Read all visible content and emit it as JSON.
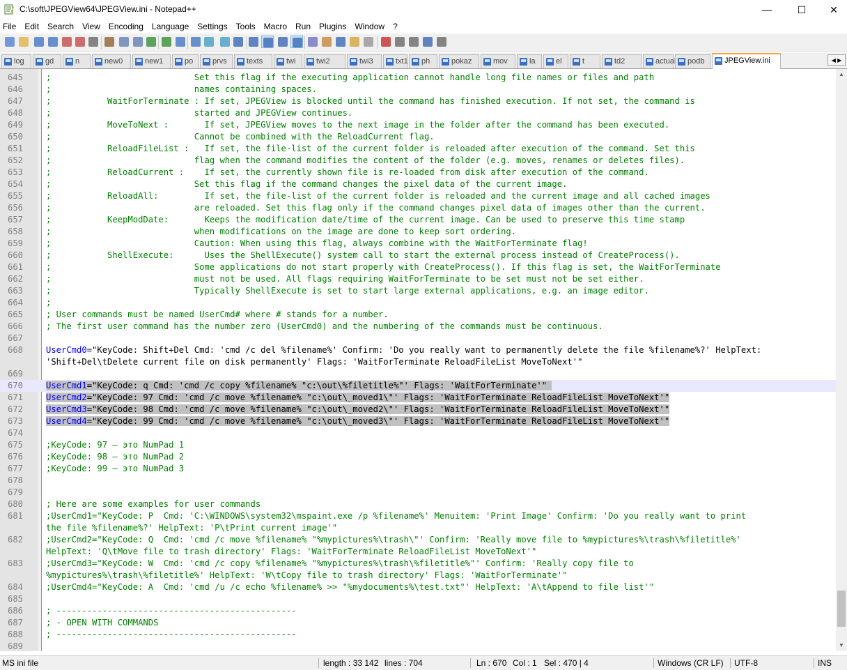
{
  "window": {
    "title": "C:\\soft\\JPEGView64\\JPEGView.ini - Notepad++",
    "minimize_glyph": "—",
    "maximize_glyph": "☐",
    "close_glyph": "✕"
  },
  "menu": [
    "File",
    "Edit",
    "Search",
    "View",
    "Encoding",
    "Language",
    "Settings",
    "Tools",
    "Macro",
    "Run",
    "Plugins",
    "Window",
    "?"
  ],
  "toolbar_icons": [
    "new-icon",
    "open-icon",
    "save-icon",
    "save-all-icon",
    "close-icon",
    "close-all-icon",
    "print-icon",
    "cut-icon",
    "copy-icon",
    "paste-icon",
    "undo-icon",
    "redo-icon",
    "find-icon",
    "replace-icon",
    "zoom-in-icon",
    "zoom-out-icon",
    "sync-vertical-icon",
    "sync-horizontal-icon",
    "word-wrap-icon",
    "show-all-chars-icon",
    "indent-guide-icon",
    "udl-icon",
    "doc-map-icon",
    "function-list-icon",
    "folder-workspace-icon",
    "monitor-icon",
    "record-macro-icon",
    "stop-macro-icon",
    "play-macro-icon",
    "run-macro-multiple-icon",
    "save-macro-icon"
  ],
  "tabs": [
    "log",
    "gd",
    "n",
    "new0",
    "new1",
    "po",
    "prvs",
    "texts",
    "twi",
    "twi2",
    "twi3",
    "txt1",
    "ph",
    "pokaz",
    "mov",
    "la",
    "el",
    "t",
    "td2",
    "actual",
    "podb",
    "JPEGView.ini"
  ],
  "active_tab": "JPEGView.ini",
  "colors": {
    "comment": "#008000",
    "key": "#0000ff",
    "text": "#000000",
    "selection": "#c0c0c0",
    "current_line": "#e8e8ff",
    "tab_accent": "#f6a336"
  },
  "editor_lines": [
    {
      "n": "645",
      "text": ";                            Set this flag if the executing application cannot handle long file names or files and path"
    },
    {
      "n": "646",
      "text": ";                            names containing spaces."
    },
    {
      "n": "647",
      "text": ";           WaitForTerminate : If set, JPEGView is blocked until the command has finished execution. If not set, the command is"
    },
    {
      "n": "648",
      "text": ";                            started and JPEGView continues."
    },
    {
      "n": "649",
      "text": ";           MoveToNext :       If set, JPEGView moves to the next image in the folder after the command has been executed."
    },
    {
      "n": "650",
      "text": ";                            Cannot be combined with the ReloadCurrent flag."
    },
    {
      "n": "651",
      "text": ";           ReloadFileList :   If set, the file-list of the current folder is reloaded after execution of the command. Set this"
    },
    {
      "n": "652",
      "text": ";                            flag when the command modifies the content of the folder (e.g. moves, renames or deletes files)."
    },
    {
      "n": "653",
      "text": ";           ReloadCurrent :    If set, the currently shown file is re-loaded from disk after execution of the command."
    },
    {
      "n": "654",
      "text": ";                            Set this flag if the command changes the pixel data of the current image."
    },
    {
      "n": "655",
      "text": ";           ReloadAll:         If set, the file-list of the current folder is reloaded and the current image and all cached images"
    },
    {
      "n": "656",
      "text": ";                            are reloaded. Set this flag only if the command changes pixel data of images other than the current."
    },
    {
      "n": "657",
      "text": ";           KeepModDate:       Keeps the modification date/time of the current image. Can be used to preserve this time stamp"
    },
    {
      "n": "658",
      "text": ";                            when modifications on the image are done to keep sort ordering."
    },
    {
      "n": "659",
      "text": ";                            Caution: When using this flag, always combine with the WaitForTerminate flag!"
    },
    {
      "n": "660",
      "text": ";           ShellExecute:      Uses the ShellExecute() system call to start the external process instead of CreateProcess()."
    },
    {
      "n": "661",
      "text": ";                            Some applications do not start properly with CreateProcess(). If this flag is set, the WaitForTerminate"
    },
    {
      "n": "662",
      "text": ";                            must not be used. All flags requiring WaitForTerminate to be set must not be set either."
    },
    {
      "n": "663",
      "text": ";                            Typically ShellExecute is set to start large external applications, e.g. an image editor."
    },
    {
      "n": "664",
      "text": ";"
    },
    {
      "n": "665",
      "text": "; User commands must be named UserCmd# where # stands for a number."
    },
    {
      "n": "666",
      "text": "; The first user command has the number zero (UserCmd0) and the numbering of the commands must be continuous."
    },
    {
      "n": "667",
      "text": ""
    },
    {
      "n": "668",
      "key": "UserCmd0",
      "value": "=\"KeyCode: Shift+Del Cmd: 'cmd /c del %filename%' Confirm: 'Do you really want to permanently delete the file %filename%?' HelpText:"
    },
    {
      "n": "",
      "value": "'Shift+Del\\tDelete current file on disk permanently' Flags: 'WaitForTerminate ReloadFileList MoveToNext'\""
    },
    {
      "n": "669",
      "text": ""
    },
    {
      "n": "670",
      "key": "UserCmd1",
      "value": "=\"KeyCode: q Cmd: 'cmd /c copy %filename% \"c:\\out\\%filetitle%\"' Flags: 'WaitForTerminate'\" ",
      "sel": true,
      "cur": true
    },
    {
      "n": "671",
      "key": "UserCmd2",
      "value": "=\"KeyCode: 97 Cmd: 'cmd /c move %filename% \"c:\\out\\_moved1\\\"' Flags: 'WaitForTerminate ReloadFileList MoveToNext'\"",
      "sel": true
    },
    {
      "n": "672",
      "key": "UserCmd3",
      "value": "=\"KeyCode: 98 Cmd: 'cmd /c move %filename% \"c:\\out\\_moved2\\\"' Flags: 'WaitForTerminate ReloadFileList MoveToNext'\"",
      "sel": true
    },
    {
      "n": "673",
      "key": "UserCmd4",
      "value": "=\"KeyCode: 99 Cmd: 'cmd /c move %filename% \"c:\\out\\_moved3\\\"' Flags: 'WaitForTerminate ReloadFileList MoveToNext'\"",
      "sel": true
    },
    {
      "n": "674",
      "text": ""
    },
    {
      "n": "675",
      "text": ";KeyCode: 97 — это NumPad 1"
    },
    {
      "n": "676",
      "text": ";KeyCode: 98 — это NumPad 2"
    },
    {
      "n": "677",
      "text": ";KeyCode: 99 — это NumPad 3"
    },
    {
      "n": "678",
      "text": ""
    },
    {
      "n": "679",
      "text": ""
    },
    {
      "n": "680",
      "text": "; Here are some examples for user commands"
    },
    {
      "n": "681",
      "text": ";UserCmd1=\"KeyCode: P  Cmd: 'C:\\WINDOWS\\system32\\mspaint.exe /p %filename%' Menuitem: 'Print Image' Confirm: 'Do you really want to print"
    },
    {
      "n": "",
      "text": "the file %filename%?' HelpText: 'P\\tPrint current image'\""
    },
    {
      "n": "682",
      "text": ";UserCmd2=\"KeyCode: Q  Cmd: 'cmd /c move %filename% \"%mypictures%\\trash\\\"' Confirm: 'Really move file to %mypictures%\\trash\\%filetitle%'"
    },
    {
      "n": "",
      "text": "HelpText: 'Q\\tMove file to trash directory' Flags: 'WaitForTerminate ReloadFileList MoveToNext'\""
    },
    {
      "n": "683",
      "text": ";UserCmd3=\"KeyCode: W  Cmd: 'cmd /c copy %filename% \"%mypictures%\\trash\\%filetitle%\"' Confirm: 'Really copy file to"
    },
    {
      "n": "",
      "text": "%mypictures%\\trash\\%filetitle%' HelpText: 'W\\tCopy file to trash directory' Flags: 'WaitForTerminate'\""
    },
    {
      "n": "684",
      "text": ";UserCmd4=\"KeyCode: A  Cmd: 'cmd /u /c echo %filename% >> \"%mydocuments%\\test.txt\"' HelpText: 'A\\tAppend to file list'\""
    },
    {
      "n": "685",
      "text": ""
    },
    {
      "n": "686",
      "text": "; -----------------------------------------------"
    },
    {
      "n": "687",
      "text": "; - OPEN WITH COMMANDS"
    },
    {
      "n": "688",
      "text": "; -----------------------------------------------"
    },
    {
      "n": "689",
      "text": ""
    }
  ],
  "status": {
    "filetype": "MS ini file",
    "length": "length : 33 142",
    "lines": "lines : 704",
    "ln": "Ln : 670",
    "col": "Col : 1",
    "sel": "Sel : 470 | 4",
    "eol": "Windows (CR LF)",
    "encoding": "UTF-8",
    "mode": "INS"
  }
}
